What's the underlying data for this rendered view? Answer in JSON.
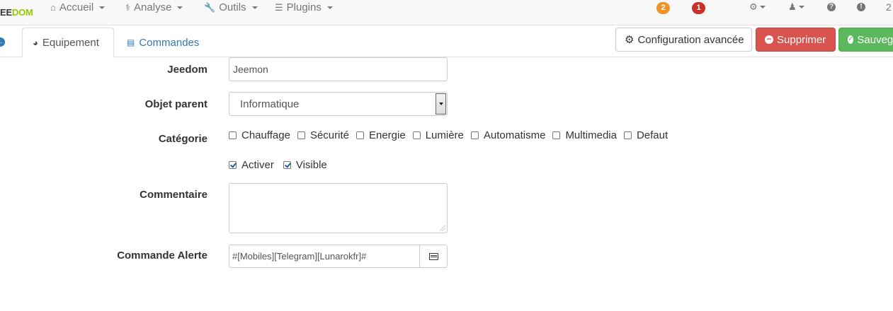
{
  "brand": {
    "part1": "EE",
    "part2": "DOM"
  },
  "nav": {
    "items": [
      {
        "label": "Accueil",
        "icon": "home-icon"
      },
      {
        "label": "Analyse",
        "icon": "stethoscope-icon"
      },
      {
        "label": "Outils",
        "icon": "wrench-icon"
      },
      {
        "label": "Plugins",
        "icon": "tasks-icon"
      }
    ],
    "badges": [
      {
        "value": "2",
        "color": "#f0932b"
      },
      {
        "value": "1",
        "color": "#c9302c"
      }
    ],
    "trailing_text": "2"
  },
  "tabs": [
    {
      "label": "Equipement",
      "icon": "tachometer-icon"
    },
    {
      "label": "Commandes",
      "icon": "list-alt-icon"
    }
  ],
  "buttons": {
    "config": "Configuration avancée",
    "delete": "Supprimer",
    "save": "Sauvegarder"
  },
  "form": {
    "jeedom": {
      "label": "Jeedom",
      "value": "Jeemon"
    },
    "parent": {
      "label": "Objet parent",
      "value": "Informatique"
    },
    "category": {
      "label": "Catégorie",
      "options": [
        {
          "label": "Chauffage",
          "checked": false
        },
        {
          "label": "Sécurité",
          "checked": false
        },
        {
          "label": "Energie",
          "checked": false
        },
        {
          "label": "Lumière",
          "checked": false
        },
        {
          "label": "Automatisme",
          "checked": false
        },
        {
          "label": "Multimedia",
          "checked": false
        },
        {
          "label": "Defaut",
          "checked": false
        }
      ]
    },
    "flags": [
      {
        "label": "Activer",
        "checked": true
      },
      {
        "label": "Visible",
        "checked": true
      }
    ],
    "comment": {
      "label": "Commentaire",
      "value": ""
    },
    "alert": {
      "label": "Commande Alerte",
      "value": "#[Mobiles][Telegram][Lunarokfr]#"
    }
  },
  "colors": {
    "brand_green": "#94ca02",
    "link_blue": "#337ab7",
    "danger": "#d9534f",
    "success": "#5cb85c"
  }
}
